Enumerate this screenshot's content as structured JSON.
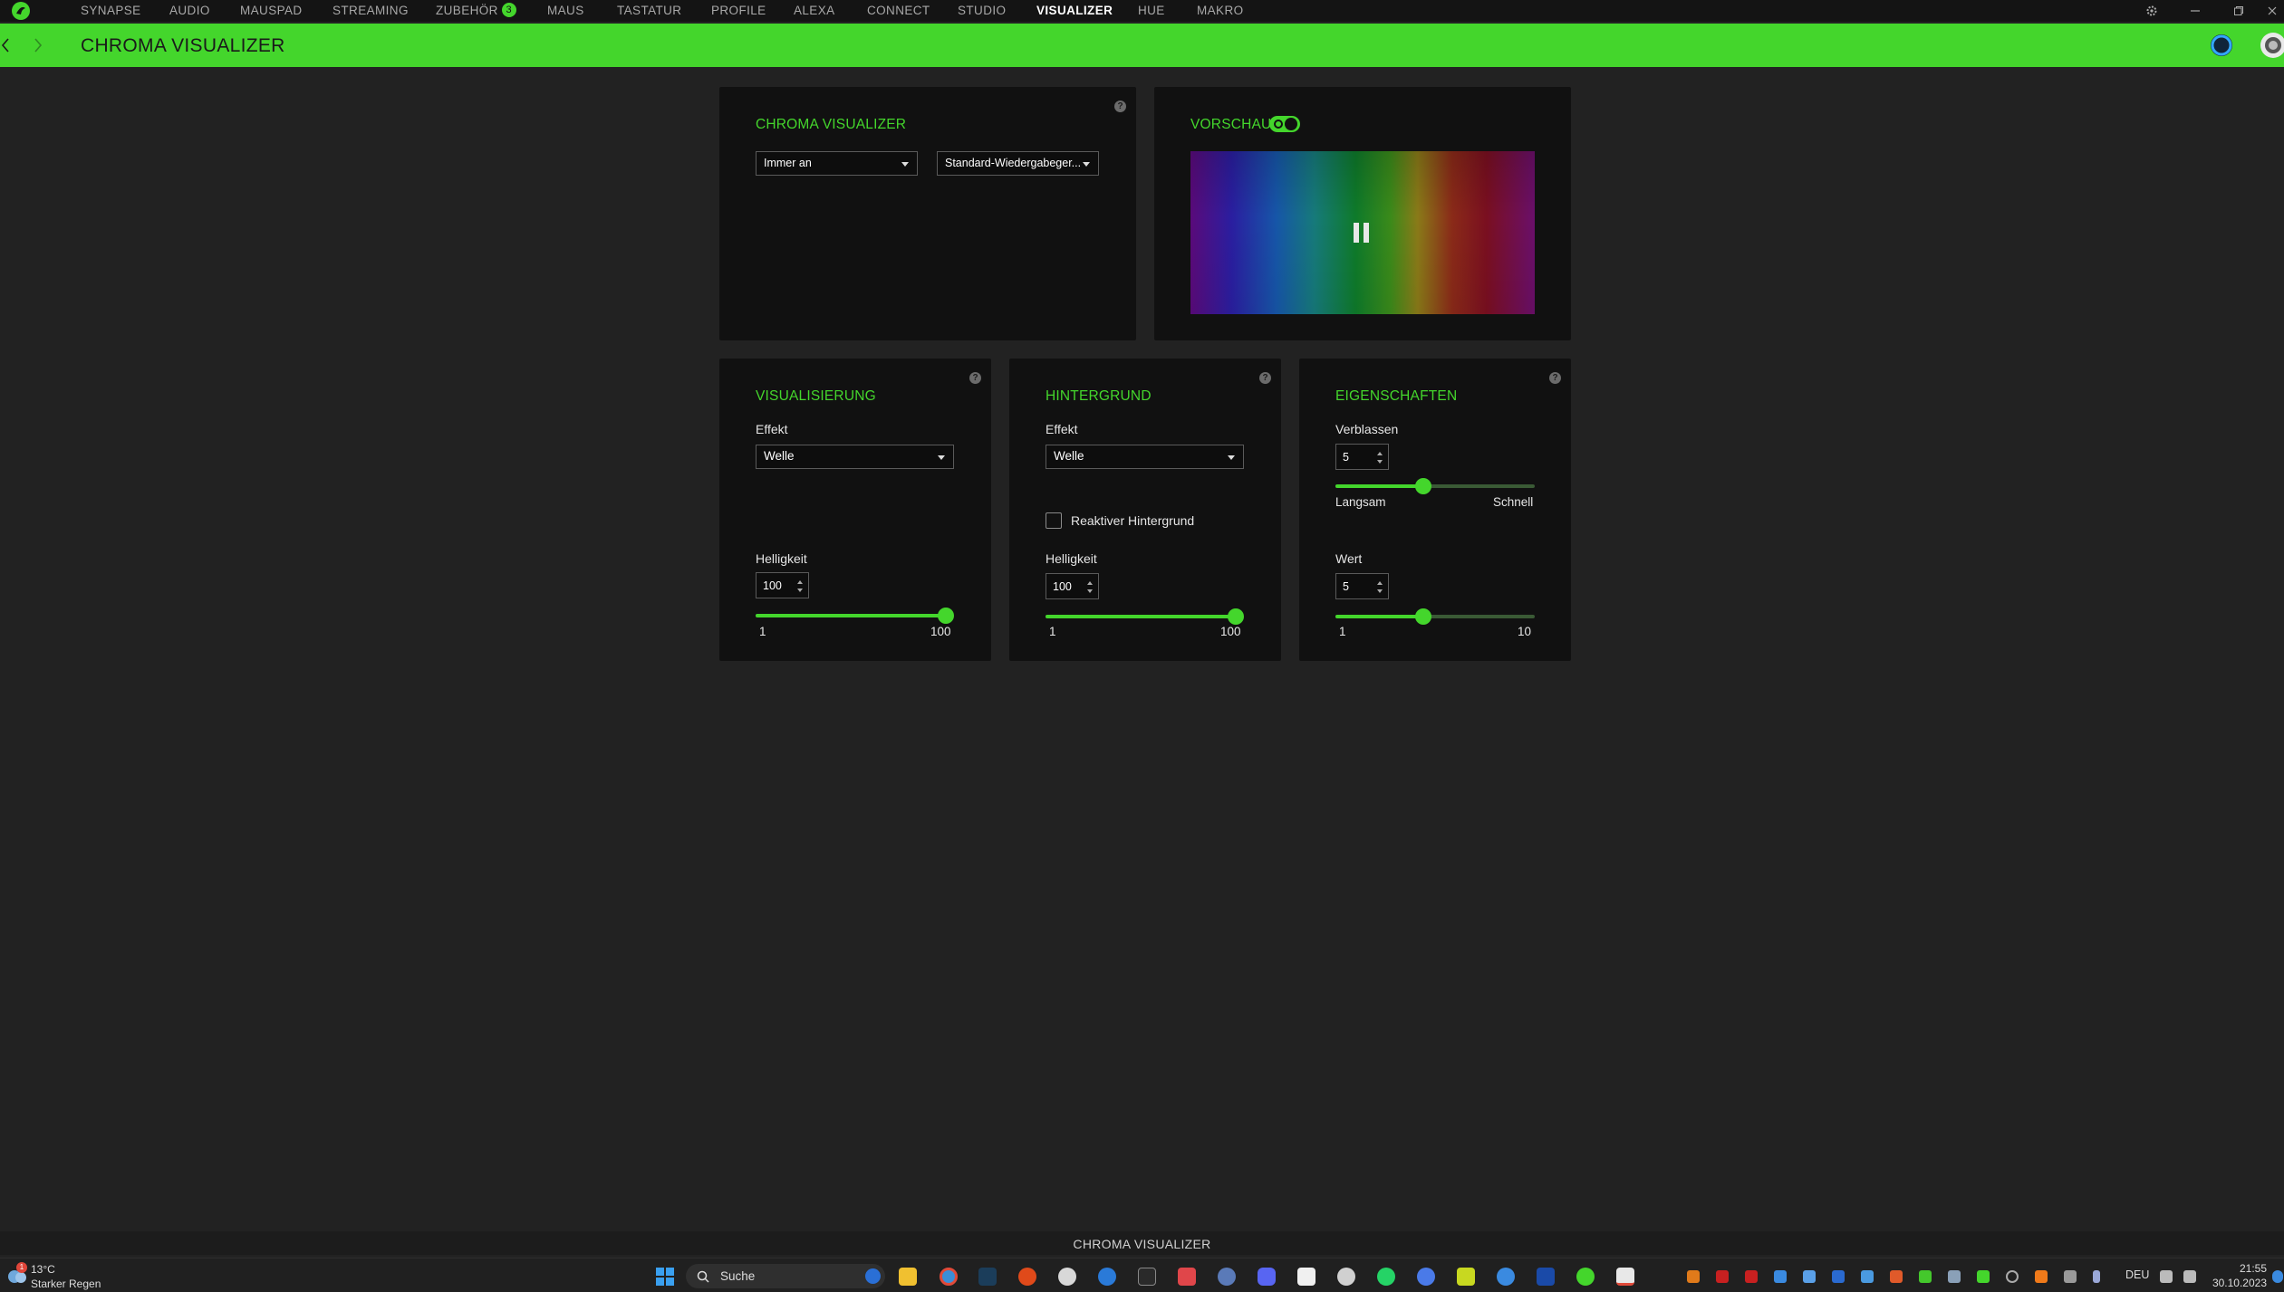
{
  "nav": {
    "items": [
      "SYNAPSE",
      "AUDIO",
      "MAUSPAD",
      "STREAMING",
      "ZUBEHÖR",
      "MAUS",
      "TASTATUR",
      "PROFILE",
      "ALEXA",
      "CONNECT",
      "STUDIO",
      "VISUALIZER",
      "HUE",
      "MAKRO"
    ],
    "active": "VISUALIZER",
    "zubehoer_badge": "3"
  },
  "header": {
    "title": "CHROMA VISUALIZER"
  },
  "chroma_panel": {
    "title": "CHROMA VISUALIZER",
    "mode_select": "Immer an",
    "device_select": "Standard-Wiedergabeger..."
  },
  "preview_panel": {
    "title": "VORSCHAU",
    "toggle_on": true
  },
  "visualization": {
    "title": "VISUALISIERUNG",
    "effect_label": "Effekt",
    "effect_value": "Welle",
    "brightness_label": "Helligkeit",
    "brightness_value": "100",
    "slider_min": "1",
    "slider_max": "100",
    "slider_fraction": 1.0
  },
  "background": {
    "title": "HINTERGRUND",
    "effect_label": "Effekt",
    "effect_value": "Welle",
    "reactive_label": "Reaktiver Hintergrund",
    "reactive_checked": false,
    "brightness_label": "Helligkeit",
    "brightness_value": "100",
    "slider_min": "1",
    "slider_max": "100",
    "slider_fraction": 1.0
  },
  "properties": {
    "title": "EIGENSCHAFTEN",
    "fade_label": "Verblassen",
    "fade_value": "5",
    "fade_min_label": "Langsam",
    "fade_max_label": "Schnell",
    "fade_fraction": 0.44,
    "value_label": "Wert",
    "value_value": "5",
    "value_min": "1",
    "value_max": "10",
    "value_fraction": 0.44
  },
  "status": {
    "text": "CHROMA VISUALIZER"
  },
  "taskbar": {
    "weather_temp": "13°C",
    "weather_desc": "Starker Regen",
    "weather_badge": "1",
    "search_placeholder": "Suche",
    "lang": "DEU",
    "time": "21:55",
    "date": "30.10.2023"
  },
  "colors": {
    "accent": "#44d62c",
    "panel": "#111111",
    "background": "#222222"
  }
}
